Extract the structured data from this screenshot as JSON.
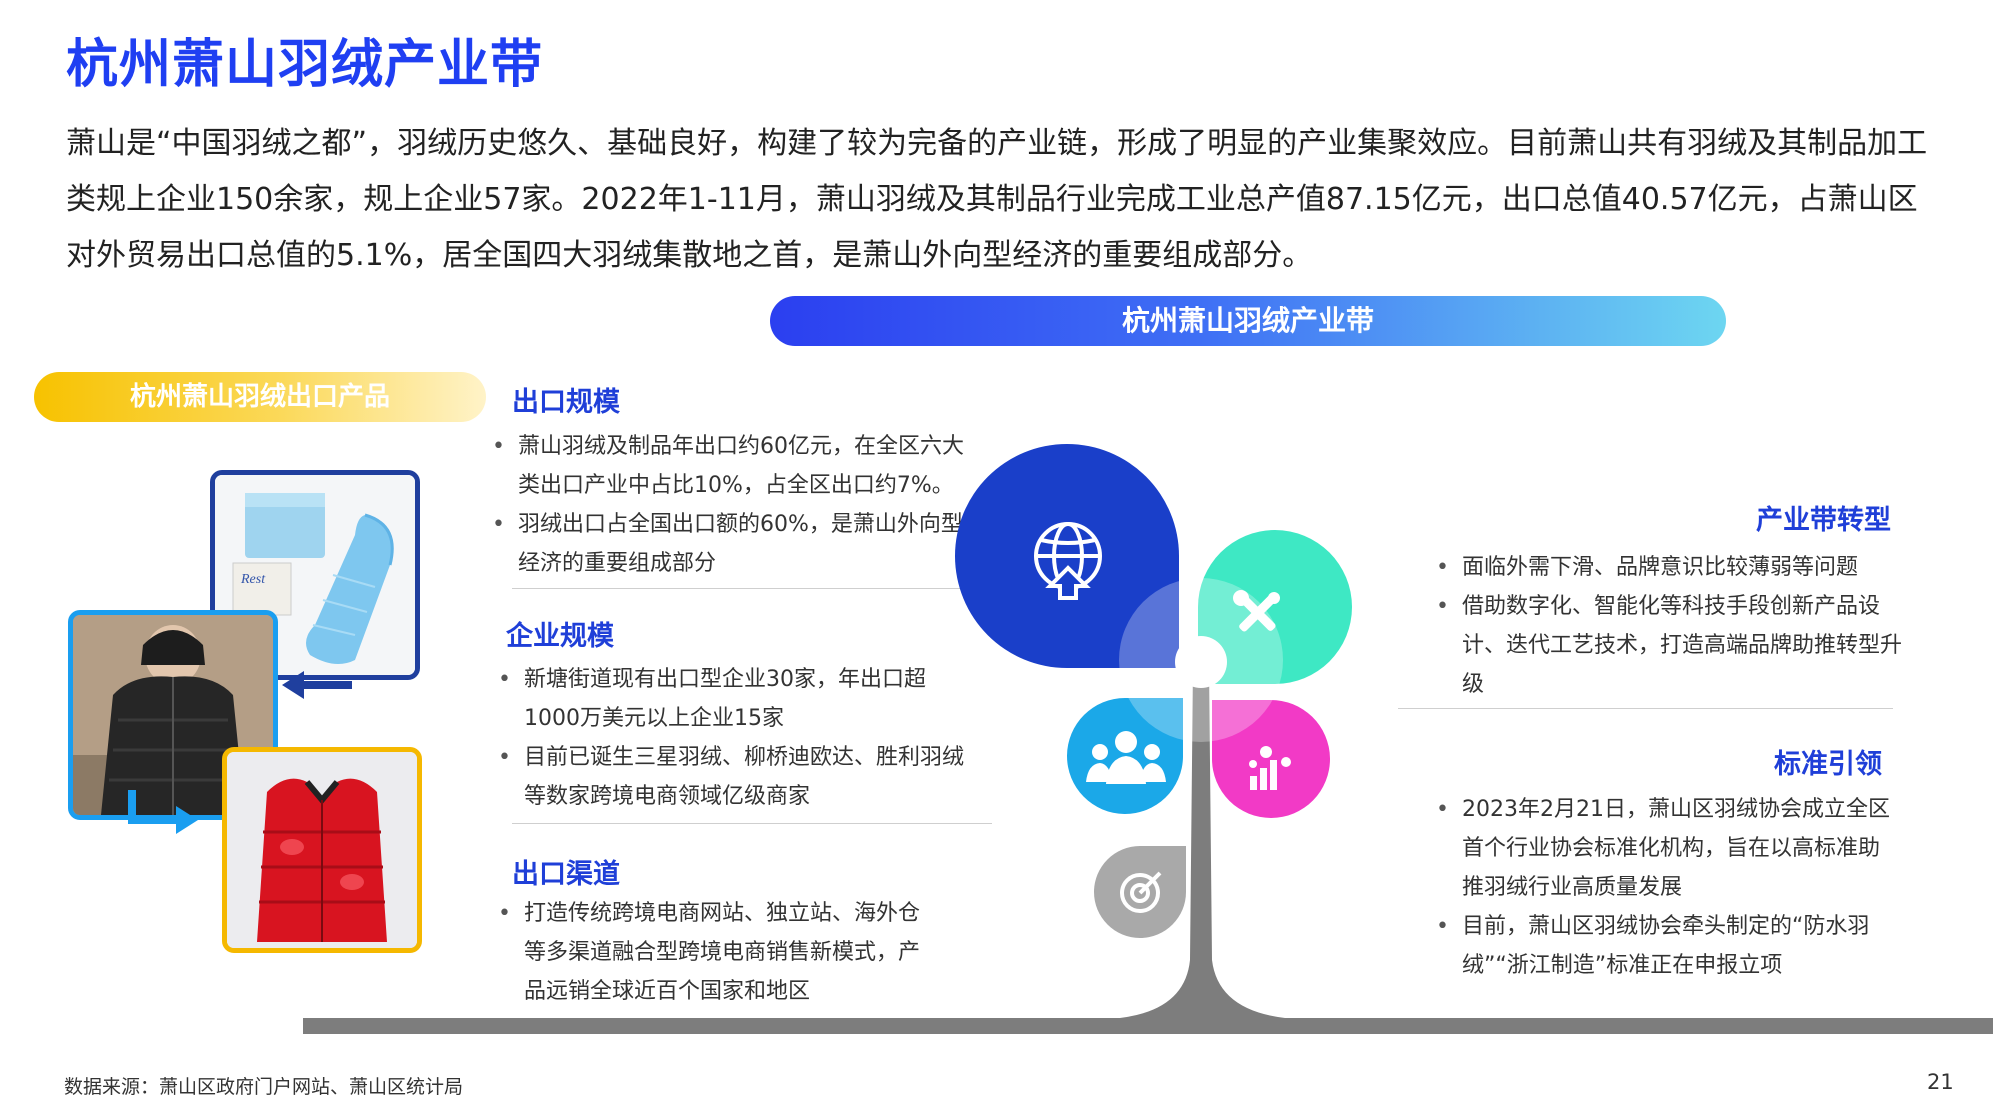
{
  "title": "杭州萧山羽绒产业带",
  "intro": "萧山是“中国羽绒之都”，羽绒历史悠久、基础良好，构建了较为完备的产业链，形成了明显的产业集聚效应。目前萧山共有羽绒及其制品加工类规上企业150余家，规上企业57家。2022年1-11月，萧山羽绒及其制品行业完成工业总产值87.15亿元，出口总值40.57亿元，占萧山区对外贸易出口总值的5.1%，居全国四大羽绒集散地之首，是萧山外向型经济的重要组成部分。",
  "banner": "杭州萧山羽绒产业带",
  "products_pill": "杭州萧山羽绒出口产品",
  "photo_brand": "Rest",
  "sections": {
    "export_scale": {
      "heading": "出口规模",
      "items": [
        "萧山羽绒及制品年出口约60亿元，在全区六大类出口产业中占比10%，占全区出口约7%。",
        "羽绒出口占全国出口额的60%，是萧山外向型经济的重要组成部分"
      ]
    },
    "enterprise_scale": {
      "heading": "企业规模",
      "items": [
        "新塘街道现有出口型企业30家，年出口超1000万美元以上企业15家",
        "目前已诞生三星羽绒、柳桥迪欧达、胜利羽绒等数家跨境电商领域亿级商家"
      ]
    },
    "export_channel": {
      "heading": "出口渠道",
      "items": [
        "打造传统跨境电商网站、独立站、海外仓等多渠道融合型跨境电商销售新模式，产品远销全球近百个国家和地区"
      ]
    },
    "transformation": {
      "heading": "产业带转型",
      "items": [
        "面临外需下滑、品牌意识比较薄弱等问题",
        "借助数字化、智能化等科技手段创新产品设计、迭代工艺技术，打造高端品牌助推转型升级"
      ]
    },
    "standards": {
      "heading": "标准引领",
      "items": [
        "2023年2月21日，萧山区羽绒协会成立全区首个行业协会标准化机构，旨在以高标准助推羽绒行业高质量发展",
        "目前，萧山区羽绒协会牵头制定的“防水羽绒”“浙江制造”标准正在申报立项"
      ]
    }
  },
  "tree_icons": [
    "globe-export-icon",
    "tools-icon",
    "people-icon",
    "growth-chart-icon",
    "target-icon"
  ],
  "colors": {
    "title_blue": "#1f3ff2",
    "leaf_blue": "#1a3fc9",
    "leaf_green": "#3ee8c4",
    "leaf_cyan": "#1ba8e8",
    "leaf_pink": "#f23ac6",
    "leaf_gray": "#a9a9a9",
    "trunk": "#7d7d7d",
    "pill_yellow": "#f7c200"
  },
  "footer": {
    "source": "数据来源：萧山区政府门户网站、萧山区统计局",
    "page_number": "21"
  }
}
